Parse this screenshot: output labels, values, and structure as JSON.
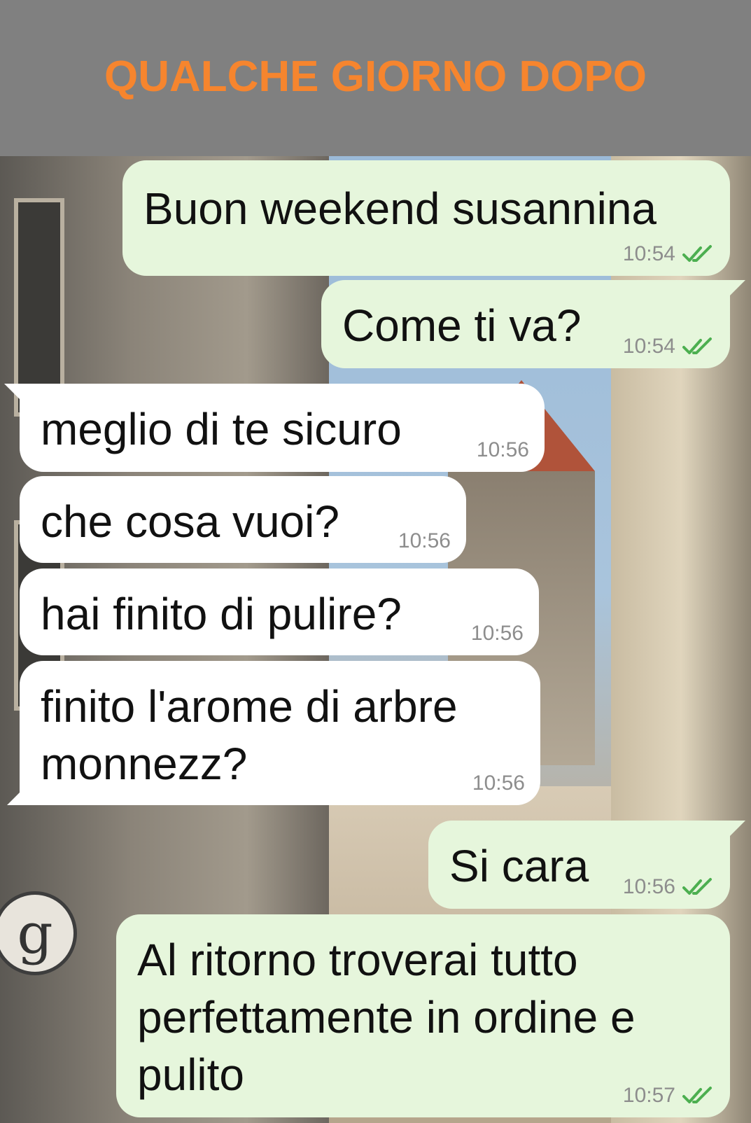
{
  "header": {
    "title": "QUALCHE GIORNO DOPO",
    "accent_color": "#f6852e"
  },
  "chat": {
    "messages": [
      {
        "direction": "outgoing",
        "text": "Buon weekend susannina",
        "time": "10:54",
        "status": "read"
      },
      {
        "direction": "outgoing",
        "text": "Come ti va?",
        "time": "10:54",
        "status": "read"
      },
      {
        "direction": "incoming",
        "text": "meglio di te sicuro",
        "time": "10:56"
      },
      {
        "direction": "incoming",
        "text": "che cosa vuoi?",
        "time": "10:56"
      },
      {
        "direction": "incoming",
        "text": "hai finito di pulire?",
        "time": "10:56"
      },
      {
        "direction": "incoming",
        "text": "finito l'arome di arbre\nmonnezz?",
        "time": "10:56"
      },
      {
        "direction": "outgoing",
        "text": "Si cara",
        "time": "10:56",
        "status": "read"
      },
      {
        "direction": "outgoing",
        "text": "Al ritorno troverai tutto\nperfettamente in ordine e\npulito",
        "time": "10:57",
        "status": "read"
      }
    ],
    "read_tick_icon": "double-check-icon",
    "read_tick_color": "#4caf50",
    "outgoing_bubble_color": "#e6f6dc",
    "incoming_bubble_color": "#ffffff",
    "wallpaper_sign_letter": "g"
  }
}
